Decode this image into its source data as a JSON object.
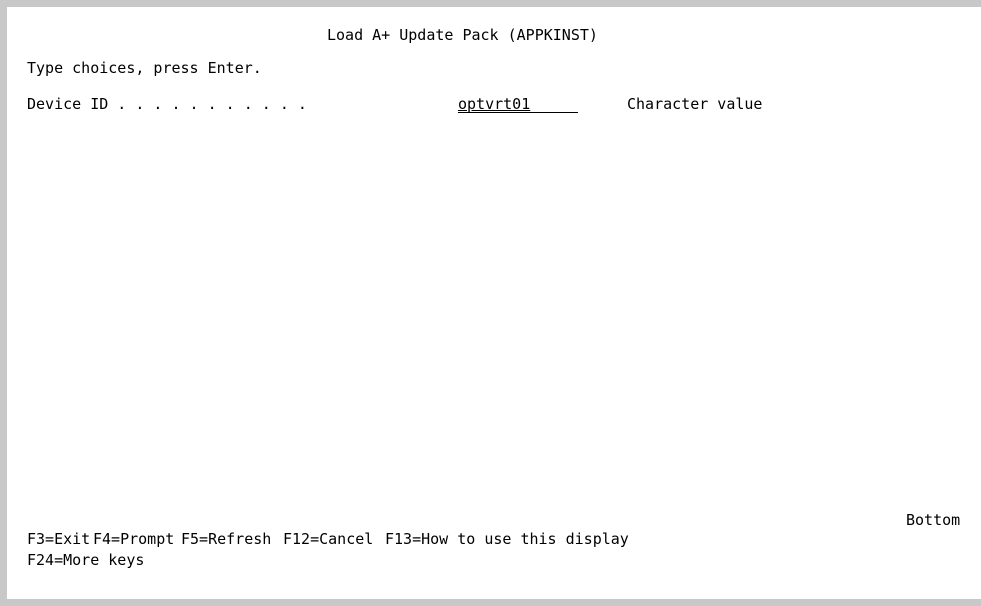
{
  "screen": {
    "title": "Load A+ Update Pack (APPKINST)",
    "instruction": "Type choices, press Enter.",
    "device_id": {
      "label": "Device ID . . . . . . . . . . .",
      "value": "optvrt01",
      "hint": "Character value"
    },
    "position_indicator": "Bottom"
  },
  "function_keys": {
    "f3": "F3=Exit",
    "f4": "F4=Prompt",
    "f5": "F5=Refresh",
    "f12": "F12=Cancel",
    "f13": "F13=How to use this display",
    "f24": "F24=More keys"
  }
}
